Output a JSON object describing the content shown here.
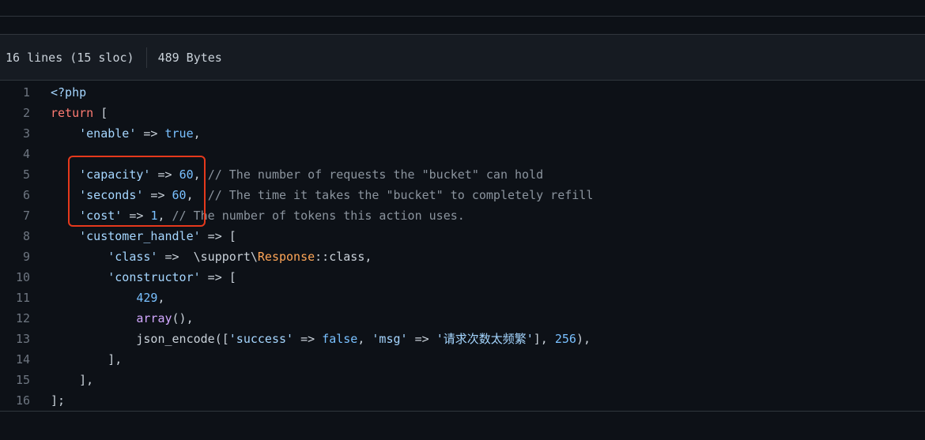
{
  "file_header": {
    "lines_info": "16 lines (15 sloc)",
    "size": "489 Bytes"
  },
  "code_lines": [
    {
      "n": "1",
      "t": [
        {
          "c": "s",
          "v": "<?php"
        }
      ]
    },
    {
      "n": "2",
      "t": [
        {
          "c": "k",
          "v": "return"
        },
        {
          "c": "p",
          "v": " ["
        }
      ]
    },
    {
      "n": "3",
      "t": [
        {
          "c": "p",
          "v": "    "
        },
        {
          "c": "s",
          "v": "'enable'"
        },
        {
          "c": "p",
          "v": " => "
        },
        {
          "c": "n",
          "v": "true"
        },
        {
          "c": "p",
          "v": ","
        }
      ]
    },
    {
      "n": "4",
      "t": []
    },
    {
      "n": "5",
      "t": [
        {
          "c": "p",
          "v": "    "
        },
        {
          "c": "s",
          "v": "'capacity'"
        },
        {
          "c": "p",
          "v": " => "
        },
        {
          "c": "n",
          "v": "60"
        },
        {
          "c": "p",
          "v": ", "
        },
        {
          "c": "cm",
          "v": "// The number of requests the \"bucket\" can hold"
        }
      ]
    },
    {
      "n": "6",
      "t": [
        {
          "c": "p",
          "v": "    "
        },
        {
          "c": "s",
          "v": "'seconds'"
        },
        {
          "c": "p",
          "v": " => "
        },
        {
          "c": "n",
          "v": "60"
        },
        {
          "c": "p",
          "v": ",  "
        },
        {
          "c": "cm",
          "v": "// The time it takes the \"bucket\" to completely refill"
        }
      ]
    },
    {
      "n": "7",
      "t": [
        {
          "c": "p",
          "v": "    "
        },
        {
          "c": "s",
          "v": "'cost'"
        },
        {
          "c": "p",
          "v": " => "
        },
        {
          "c": "n",
          "v": "1"
        },
        {
          "c": "p",
          "v": ", "
        },
        {
          "c": "cm",
          "v": "// The number of tokens this action uses."
        }
      ]
    },
    {
      "n": "8",
      "t": [
        {
          "c": "p",
          "v": "    "
        },
        {
          "c": "s",
          "v": "'customer_handle'"
        },
        {
          "c": "p",
          "v": " => ["
        }
      ]
    },
    {
      "n": "9",
      "t": [
        {
          "c": "p",
          "v": "        "
        },
        {
          "c": "s",
          "v": "'class'"
        },
        {
          "c": "p",
          "v": " =>  \\support\\"
        },
        {
          "c": "cls",
          "v": "Response"
        },
        {
          "c": "p",
          "v": "::class,"
        }
      ]
    },
    {
      "n": "10",
      "t": [
        {
          "c": "p",
          "v": "        "
        },
        {
          "c": "s",
          "v": "'constructor'"
        },
        {
          "c": "p",
          "v": " => ["
        }
      ]
    },
    {
      "n": "11",
      "t": [
        {
          "c": "p",
          "v": "            "
        },
        {
          "c": "n",
          "v": "429"
        },
        {
          "c": "p",
          "v": ","
        }
      ]
    },
    {
      "n": "12",
      "t": [
        {
          "c": "p",
          "v": "            "
        },
        {
          "c": "fn",
          "v": "array"
        },
        {
          "c": "p",
          "v": "(),"
        }
      ]
    },
    {
      "n": "13",
      "t": [
        {
          "c": "p",
          "v": "            json_encode(["
        },
        {
          "c": "s",
          "v": "'success'"
        },
        {
          "c": "p",
          "v": " => "
        },
        {
          "c": "n",
          "v": "false"
        },
        {
          "c": "p",
          "v": ", "
        },
        {
          "c": "s",
          "v": "'msg'"
        },
        {
          "c": "p",
          "v": " => "
        },
        {
          "c": "s",
          "v": "'请求次数太频繁'"
        },
        {
          "c": "p",
          "v": "], "
        },
        {
          "c": "n",
          "v": "256"
        },
        {
          "c": "p",
          "v": "),"
        }
      ]
    },
    {
      "n": "14",
      "t": [
        {
          "c": "p",
          "v": "        ],"
        }
      ]
    },
    {
      "n": "15",
      "t": [
        {
          "c": "p",
          "v": "    ],"
        }
      ]
    },
    {
      "n": "16",
      "t": [
        {
          "c": "p",
          "v": "];"
        }
      ]
    }
  ],
  "highlight": {
    "color": "#e5391c",
    "lines": [
      "5",
      "6",
      "7"
    ]
  },
  "colors": {
    "background": "#0d1117",
    "header_bg": "#161b22",
    "keyword": "#ff7b72",
    "string": "#a5d6ff",
    "constant": "#79c0ff",
    "comment": "#8b949e",
    "class": "#ffa657",
    "function": "#d2a8ff"
  }
}
